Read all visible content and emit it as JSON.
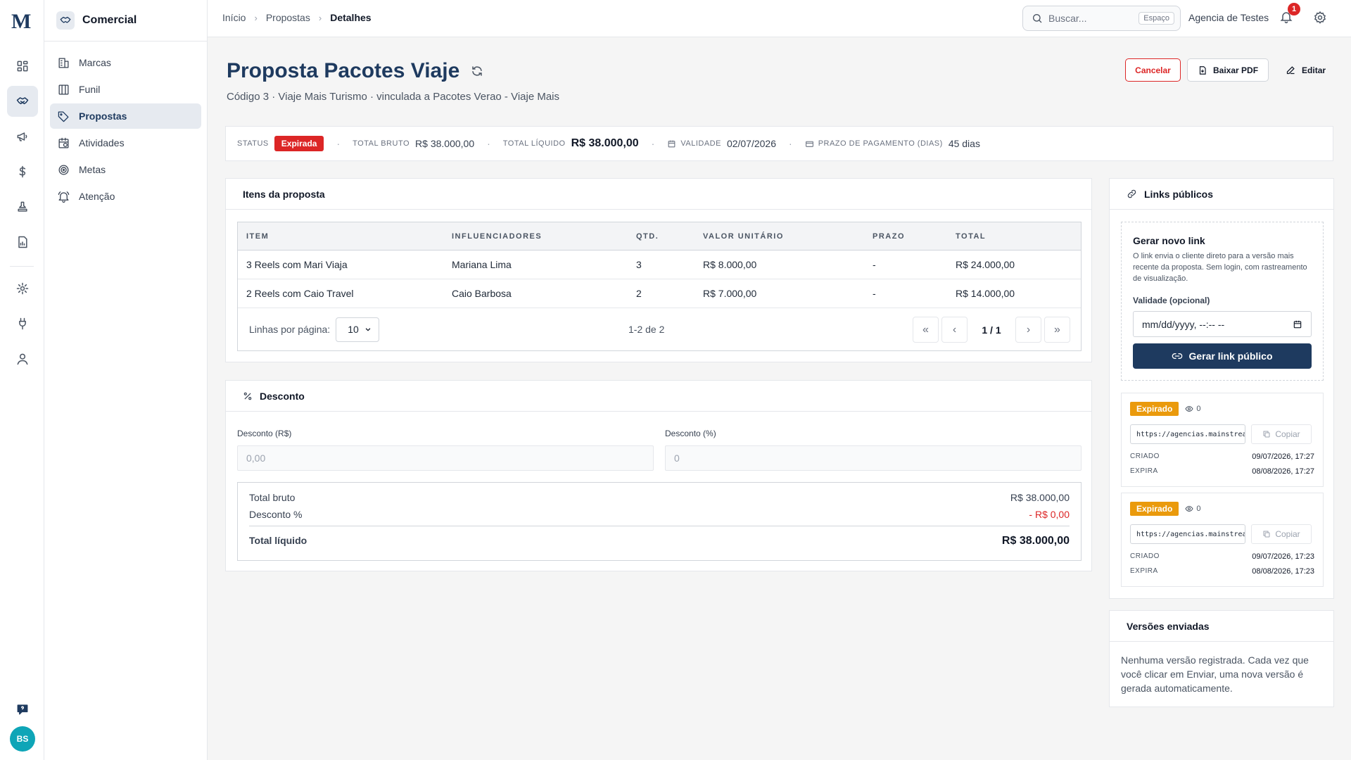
{
  "rail": {
    "logo": "M",
    "avatar": "BS"
  },
  "sidenav": {
    "title": "Comercial",
    "items": [
      {
        "label": "Marcas",
        "icon": "building-icon"
      },
      {
        "label": "Funil",
        "icon": "columns-icon"
      },
      {
        "label": "Propostas",
        "icon": "tag-icon",
        "active": true
      },
      {
        "label": "Atividades",
        "icon": "calendar-clock-icon"
      },
      {
        "label": "Metas",
        "icon": "target-icon"
      },
      {
        "label": "Atenção",
        "icon": "bell-ring-icon"
      }
    ]
  },
  "topbar": {
    "breadcrumb": [
      "Início",
      "Propostas",
      "Detalhes"
    ],
    "search_placeholder": "Buscar...",
    "search_shortcut": "Espaço",
    "agency": "Agencia de Testes",
    "notifications": "1"
  },
  "header": {
    "title": "Proposta Pacotes Viaje",
    "subtitle": "Código 3 · Viaje Mais Turismo · vinculada a Pacotes Verao - Viaje Mais",
    "cancel": "Cancelar",
    "download": "Baixar PDF",
    "edit": "Editar"
  },
  "status": {
    "status_label": "STATUS",
    "status_value": "Expirada",
    "gross_label": "TOTAL BRUTO",
    "gross_value": "R$ 38.000,00",
    "net_label": "TOTAL LÍQUIDO",
    "net_value": "R$ 38.000,00",
    "validity_label": "VALIDADE",
    "validity_value": "02/07/2026",
    "term_label": "PRAZO DE PAGAMENTO (DIAS)",
    "term_value": "45 dias",
    "dot": "·"
  },
  "items": {
    "title": "Itens da proposta",
    "columns": [
      "ITEM",
      "INFLUENCIADORES",
      "QTD.",
      "VALOR UNITÁRIO",
      "PRAZO",
      "TOTAL"
    ],
    "rows": [
      [
        "3 Reels com Mari Viaja",
        "Mariana Lima",
        "3",
        "R$ 8.000,00",
        "-",
        "R$ 24.000,00"
      ],
      [
        "2 Reels com Caio Travel",
        "Caio Barbosa",
        "2",
        "R$ 7.000,00",
        "-",
        "R$ 14.000,00"
      ]
    ],
    "rows_per_page_label": "Linhas por página:",
    "rows_per_page": "10",
    "range": "1-2 de 2",
    "page": "1 / 1"
  },
  "discount": {
    "title": "Desconto",
    "brl_label": "Desconto (R$)",
    "brl_placeholder": "0,00",
    "pct_label": "Desconto (%)",
    "pct_placeholder": "0",
    "gross_label": "Total bruto",
    "gross_value": "R$ 38.000,00",
    "pct_row_label": "Desconto %",
    "pct_row_value": "- R$ 0,00",
    "net_label": "Total líquido",
    "net_value": "R$ 38.000,00"
  },
  "links": {
    "title": "Links públicos",
    "gen_title": "Gerar novo link",
    "gen_desc": "O link envia o cliente direto para a versão mais recente da proposta. Sem login, com rastreamento de visualização.",
    "validity_label": "Validade (opcional)",
    "validity_placeholder": "mm/dd/yyyy, --:-- --",
    "gen_button": "Gerar link público",
    "entries": [
      {
        "status": "Expirado",
        "views": "0",
        "url": "https://agencias.mainstream",
        "copy": "Copiar",
        "created_label": "CRIADO",
        "created": "09/07/2026, 17:27",
        "expires_label": "EXPIRA",
        "expires": "08/08/2026, 17:27"
      },
      {
        "status": "Expirado",
        "views": "0",
        "url": "https://agencias.mainstream",
        "copy": "Copiar",
        "created_label": "CRIADO",
        "created": "09/07/2026, 17:23",
        "expires_label": "EXPIRA",
        "expires": "08/08/2026, 17:23"
      }
    ]
  },
  "versions": {
    "title": "Versões enviadas",
    "empty": "Nenhuma versão registrada. Cada vez que você clicar em Enviar, uma nova versão é gerada automaticamente."
  },
  "colors": {
    "brand": "#1e3a5f",
    "danger": "#dc2626",
    "warning": "#ea9a0c",
    "teal": "#0ea5b7"
  }
}
